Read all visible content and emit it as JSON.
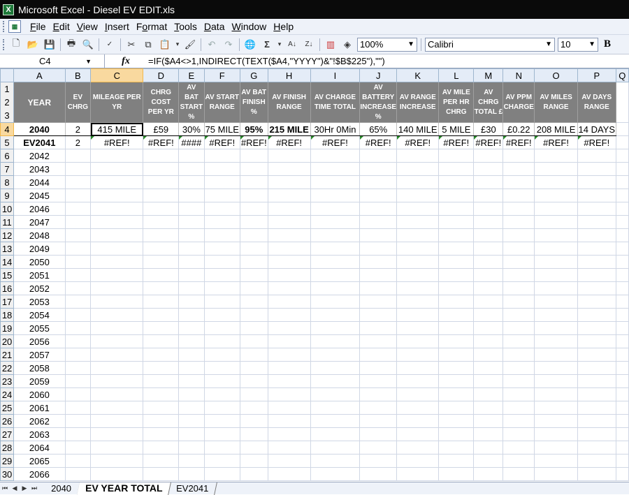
{
  "window": {
    "title": "Microsoft Excel - Diesel EV EDIT.xls"
  },
  "menu": [
    {
      "pre": "",
      "u": "F",
      "post": "ile"
    },
    {
      "pre": "",
      "u": "E",
      "post": "dit"
    },
    {
      "pre": "",
      "u": "V",
      "post": "iew"
    },
    {
      "pre": "",
      "u": "I",
      "post": "nsert"
    },
    {
      "pre": "F",
      "u": "o",
      "post": "rmat"
    },
    {
      "pre": "",
      "u": "T",
      "post": "ools"
    },
    {
      "pre": "",
      "u": "D",
      "post": "ata"
    },
    {
      "pre": "",
      "u": "W",
      "post": "indow"
    },
    {
      "pre": "",
      "u": "H",
      "post": "elp"
    }
  ],
  "toolbar": {
    "zoom": "100%",
    "font": "Calibri",
    "size": "10",
    "bold_label": "B"
  },
  "formula": {
    "cell_ref": "C4",
    "fx_label": "fx",
    "text": "=IF($A4<>1,INDIRECT(TEXT($A4,\"YYYY\")&\"!$B$225\"),\"\")"
  },
  "columns": [
    "A",
    "B",
    "C",
    "D",
    "E",
    "F",
    "G",
    "H",
    "I",
    "J",
    "K",
    "L",
    "M",
    "N",
    "O",
    "P",
    "Q"
  ],
  "headers": [
    "YEAR",
    "EV CHRG",
    "MILEAGE PER YR",
    "CHRG COST PER YR",
    "AV BAT START %",
    "AV START RANGE",
    "AV BAT FINISH %",
    "AV FINISH RANGE",
    "AV CHARGE TIME TOTAL",
    "AV BATTERY INCREASE %",
    "AV RANGE INCREASE",
    "AV MILE PER HR CHRG",
    "AV CHRG TOTAL £",
    "AV PPM CHARGE",
    "AV MILES RANGE",
    "AV DAYS RANGE"
  ],
  "header_rows": [
    "1",
    "2",
    "3"
  ],
  "row4": {
    "num": "4",
    "cells": [
      "2040",
      "2",
      "415 MILE",
      "£59",
      "30%",
      "75 MILE",
      "95%",
      "215 MILE",
      "30Hr 0Min",
      "65%",
      "140 MILE",
      "5 MILE",
      "£30",
      "£0.22",
      "208 MILE",
      "14 DAYS"
    ]
  },
  "row5": {
    "num": "5",
    "cells": [
      "EV2041",
      "2",
      "#REF!",
      "#REF!",
      "####",
      "#REF!",
      "#REF!",
      "#REF!",
      "#REF!",
      "#REF!",
      "#REF!",
      "#REF!",
      "#REF!",
      "#REF!",
      "#REF!",
      "#REF!"
    ]
  },
  "rows": [
    {
      "num": "6",
      "year": "2042"
    },
    {
      "num": "7",
      "year": "2043"
    },
    {
      "num": "8",
      "year": "2044"
    },
    {
      "num": "9",
      "year": "2045"
    },
    {
      "num": "10",
      "year": "2046"
    },
    {
      "num": "11",
      "year": "2047"
    },
    {
      "num": "12",
      "year": "2048"
    },
    {
      "num": "13",
      "year": "2049"
    },
    {
      "num": "14",
      "year": "2050"
    },
    {
      "num": "15",
      "year": "2051"
    },
    {
      "num": "16",
      "year": "2052"
    },
    {
      "num": "17",
      "year": "2053"
    },
    {
      "num": "18",
      "year": "2054"
    },
    {
      "num": "19",
      "year": "2055"
    },
    {
      "num": "20",
      "year": "2056"
    },
    {
      "num": "21",
      "year": "2057"
    },
    {
      "num": "22",
      "year": "2058"
    },
    {
      "num": "23",
      "year": "2059"
    },
    {
      "num": "24",
      "year": "2060"
    },
    {
      "num": "25",
      "year": "2061"
    },
    {
      "num": "26",
      "year": "2062"
    },
    {
      "num": "27",
      "year": "2063"
    },
    {
      "num": "28",
      "year": "2064"
    },
    {
      "num": "29",
      "year": "2065"
    },
    {
      "num": "30",
      "year": "2066"
    }
  ],
  "sheets": [
    {
      "name": "2040",
      "active": false
    },
    {
      "name": "EV YEAR TOTAL",
      "active": true
    },
    {
      "name": "EV2041",
      "active": false
    }
  ],
  "colors": {
    "header_bg": "#808080",
    "selection": "#f9d99f",
    "title_bg": "#0a0a0a",
    "error_triangle": "#2a8a2a"
  }
}
